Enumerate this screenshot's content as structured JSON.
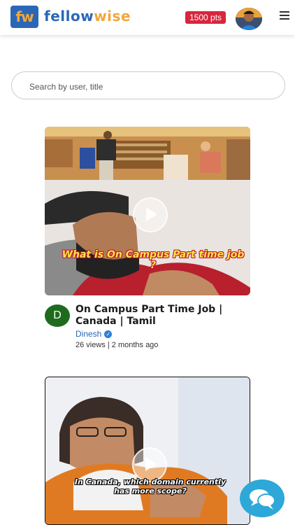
{
  "header": {
    "logo_mark": "fw",
    "brand_part1": "fellow",
    "brand_part2": "wise",
    "points_label": "1500 pts",
    "menu_icon": "hamburger-icon"
  },
  "search": {
    "placeholder": "Search by user, title"
  },
  "videos": [
    {
      "thumbnail_caption": "What is On Campus Part time job ?",
      "title": "On Campus Part Time Job | Canada | Tamil",
      "channel_initial": "D",
      "channel_name": "Dinesh",
      "meta": "26 views | 2 months ago"
    },
    {
      "thumbnail_caption": "In Canada, which domain currently has more scope?"
    }
  ],
  "colors": {
    "brand_blue": "#2b67b7",
    "brand_orange": "#f0a73b",
    "points_red": "#d7263d",
    "chat_blue": "#2da8d8"
  }
}
